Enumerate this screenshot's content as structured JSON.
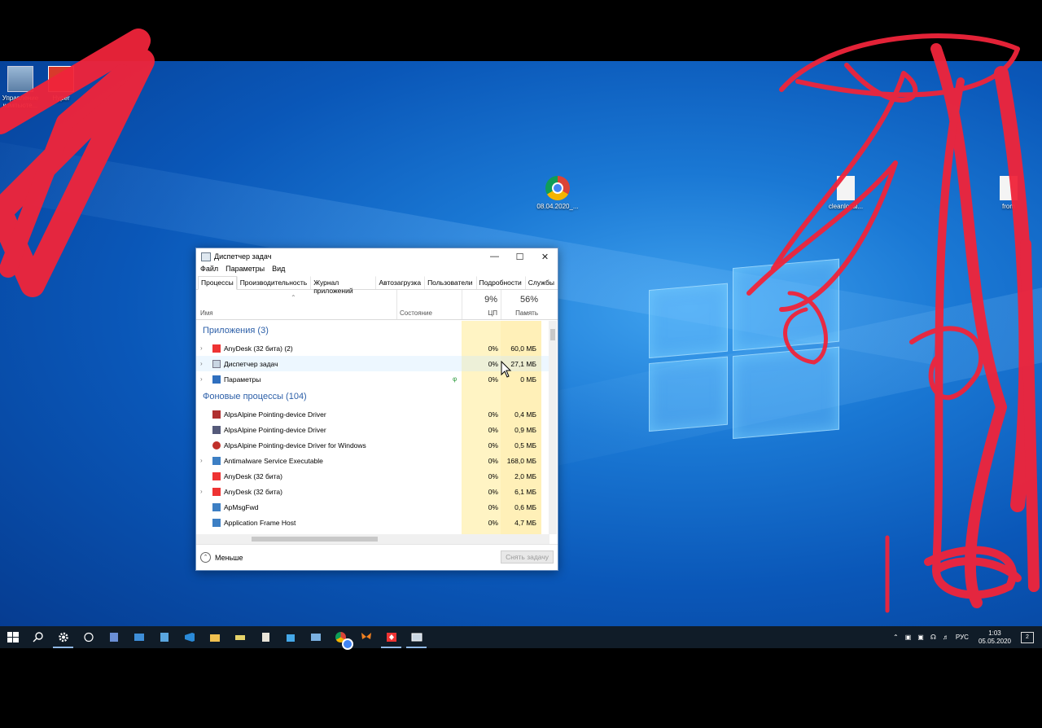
{
  "desktop": {
    "icons": [
      {
        "name": "computer-management",
        "label": "Управление компьюте..."
      },
      {
        "name": "hyper-v",
        "label": "Hyper"
      },
      {
        "name": "chrome",
        "label": "08.04.2020_..."
      },
      {
        "name": "cleanlocal",
        "label": "cleanlocal..."
      },
      {
        "name": "from",
        "label": "from"
      }
    ]
  },
  "window": {
    "title": "Диспетчер задач",
    "menu": [
      "Файл",
      "Параметры",
      "Вид"
    ],
    "tabs": [
      "Процессы",
      "Производительность",
      "Журнал приложений",
      "Автозагрузка",
      "Пользователи",
      "Подробности",
      "Службы"
    ],
    "columns": {
      "name": "Имя",
      "status": "Состояние",
      "cpu_pct": "9%",
      "cpu": "ЦП",
      "mem_pct": "56%",
      "mem": "Память"
    },
    "groups": {
      "apps": "Приложения (3)",
      "background": "Фоновые процессы (104)"
    },
    "apps": [
      {
        "name": "AnyDesk (32 бита) (2)",
        "cpu": "0%",
        "mem": "60,0 МБ"
      },
      {
        "name": "Диспетчер задач",
        "cpu": "0%",
        "mem": "27,1 МБ"
      },
      {
        "name": "Параметры",
        "cpu": "0%",
        "mem": "0 МБ"
      }
    ],
    "background": [
      {
        "name": "AlpsAlpine Pointing-device Driver",
        "cpu": "0%",
        "mem": "0,4 МБ"
      },
      {
        "name": "AlpsAlpine Pointing-device Driver",
        "cpu": "0%",
        "mem": "0,9 МБ"
      },
      {
        "name": "AlpsAlpine Pointing-device Driver for Windows",
        "cpu": "0%",
        "mem": "0,5 МБ"
      },
      {
        "name": "Antimalware Service Executable",
        "cpu": "0%",
        "mem": "168,0 МБ"
      },
      {
        "name": "AnyDesk (32 бита)",
        "cpu": "0%",
        "mem": "2,0 МБ"
      },
      {
        "name": "AnyDesk (32 бита)",
        "cpu": "0%",
        "mem": "6,1 МБ"
      },
      {
        "name": "ApMsgFwd",
        "cpu": "0%",
        "mem": "0,6 МБ"
      },
      {
        "name": "Application Frame Host",
        "cpu": "0%",
        "mem": "4,7 МБ"
      }
    ],
    "footer": {
      "less": "Меньше",
      "end_task": "Снять задачу"
    }
  },
  "taskbar": {
    "tray": {
      "lang": "РУС",
      "time": "1:03",
      "date": "05.05.2020",
      "notifications": "2"
    }
  },
  "colors": {
    "cpu_col": "#fff4c4",
    "mem_col": "#fff0b8",
    "group": "#2c5fa8",
    "scribble": "#f0243a"
  }
}
